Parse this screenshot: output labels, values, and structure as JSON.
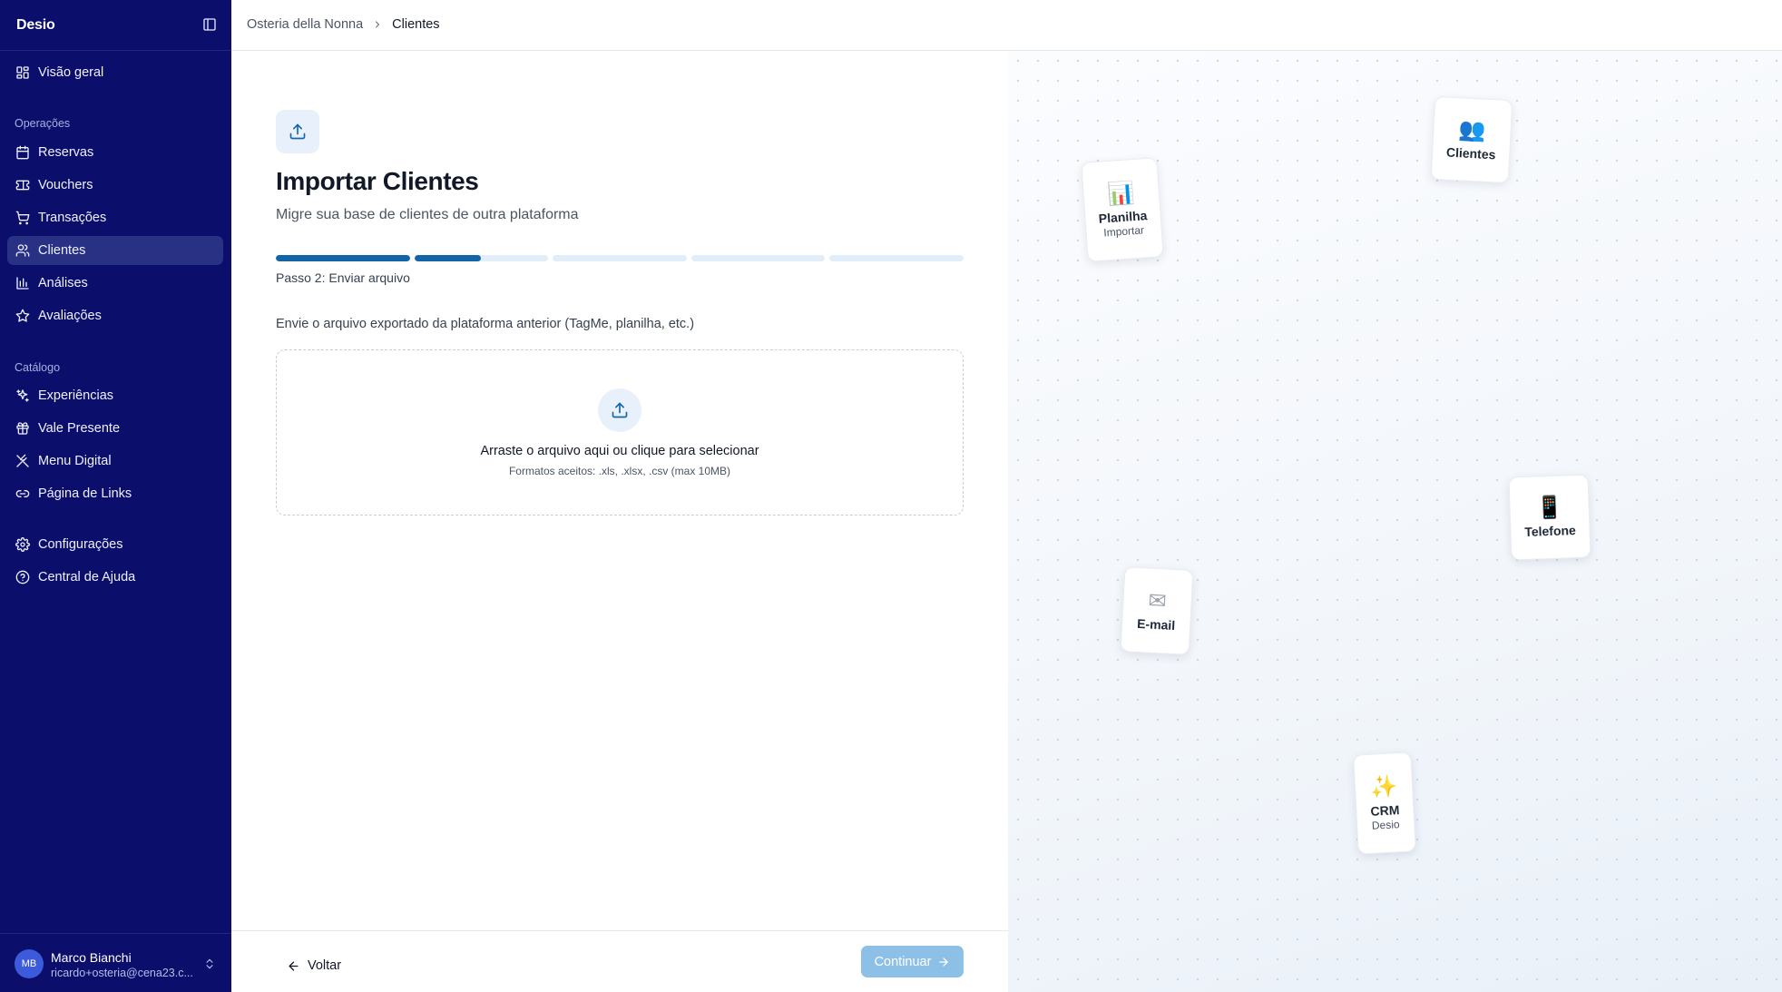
{
  "app": {
    "brand": "Desio"
  },
  "sidebar": {
    "overview": "Visão geral",
    "sections": {
      "operations": "Operações",
      "catalog": "Catálogo"
    },
    "items": {
      "reservas": "Reservas",
      "vouchers": "Vouchers",
      "transacoes": "Transações",
      "clientes": "Clientes",
      "analises": "Análises",
      "avaliacoes": "Avaliações",
      "experiencias": "Experiências",
      "vale_presente": "Vale Presente",
      "menu_digital": "Menu Digital",
      "pagina_links": "Página de Links",
      "configuracoes": "Configurações",
      "central_ajuda": "Central de Ajuda"
    },
    "active_item": "clientes",
    "user": {
      "initials": "MB",
      "name": "Marco Bianchi",
      "email": "ricardo+osteria@cena23.c..."
    }
  },
  "header": {
    "breadcrumb": {
      "parent": "Osteria della Nonna",
      "current": "Clientes"
    }
  },
  "main": {
    "title": "Importar Clientes",
    "subtitle": "Migre sua base de clientes de outra plataforma",
    "progress": {
      "total_steps": 5,
      "current_step": 2,
      "segments_fill": [
        1,
        0.5,
        0,
        0,
        0
      ],
      "label": "Passo 2: Enviar arquivo"
    },
    "instruction": "Envie o arquivo exportado da plataforma anterior (TagMe, planilha, etc.)",
    "dropzone": {
      "title": "Arraste o arquivo aqui ou clique para selecionar",
      "formats": "Formatos aceitos: .xls, .xlsx, .csv (max 10MB)"
    },
    "footer": {
      "back_label": "Voltar",
      "continue_label": "Continuar"
    }
  },
  "decor": {
    "cards": {
      "planilha": {
        "emoji": "📊",
        "label": "Planilha",
        "sub": "Importar"
      },
      "clientes": {
        "emoji": "👥",
        "label": "Clientes"
      },
      "telefone": {
        "emoji": "📱",
        "label": "Telefone"
      },
      "email": {
        "emoji": "✉",
        "label": "E-mail"
      },
      "crm": {
        "emoji": "✨",
        "label": "CRM",
        "sub": "Desio"
      }
    }
  },
  "colors": {
    "sidebar_bg": "#0b0f6b",
    "active_item_bg": "#283184",
    "accent": "#1465a8",
    "progress_track": "#e1eef9",
    "continue_disabled": "#8cc0e6"
  }
}
